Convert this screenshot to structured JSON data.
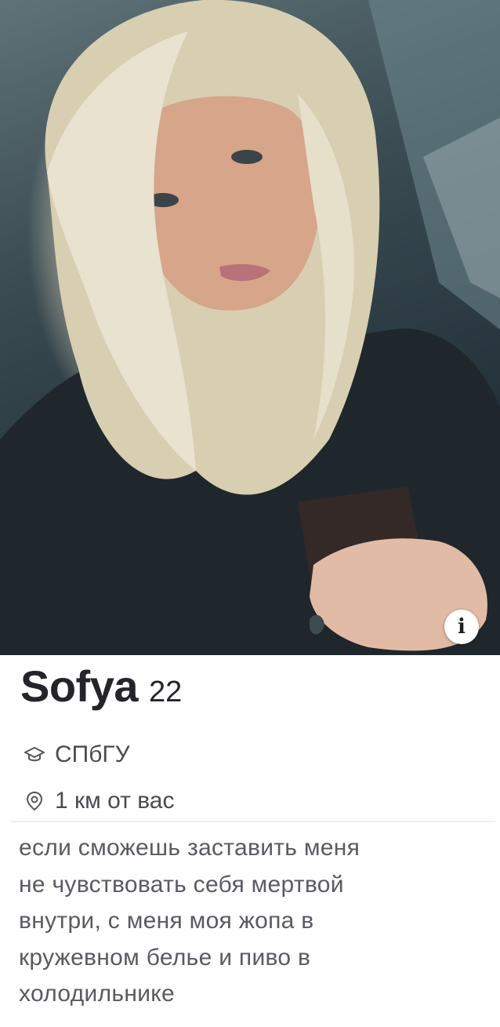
{
  "profile": {
    "name": "Sofya",
    "age": "22",
    "school": "СПбГУ",
    "distance": "1 км от вас",
    "bio_lines": [
      "если сможешь заставить меня",
      "не чувствовать себя мертвой",
      "внутри, с меня моя жопа в",
      "кружевном белье и пиво в",
      "холодильнике"
    ]
  },
  "icons": {
    "info": "info-icon",
    "school": "graduation-cap-icon",
    "location": "location-pin-icon"
  },
  "info_glyph": "i"
}
